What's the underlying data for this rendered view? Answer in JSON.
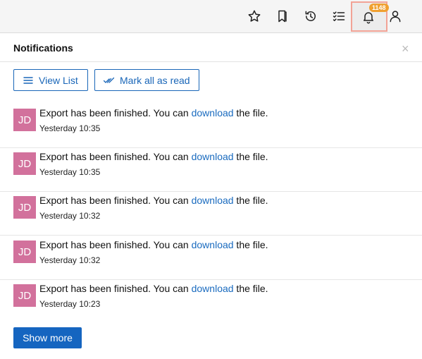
{
  "toolbar": {
    "icons": [
      "star-icon",
      "bookmark-icon",
      "history-icon",
      "checklist-icon",
      "bell-icon",
      "user-icon"
    ],
    "notification_count": "1148"
  },
  "panel": {
    "title": "Notifications",
    "close_glyph": "×",
    "view_list_label": "View List",
    "mark_all_read_label": "Mark all as read",
    "show_more_label": "Show more"
  },
  "notifications": [
    {
      "initials": "JD",
      "text_before": "Export has been finished. You can ",
      "link": "download",
      "text_after": " the file.",
      "time": "Yesterday 10:35"
    },
    {
      "initials": "JD",
      "text_before": "Export has been finished. You can ",
      "link": "download",
      "text_after": " the file.",
      "time": "Yesterday 10:35"
    },
    {
      "initials": "JD",
      "text_before": "Export has been finished. You can ",
      "link": "download",
      "text_after": " the file.",
      "time": "Yesterday 10:32"
    },
    {
      "initials": "JD",
      "text_before": "Export has been finished. You can ",
      "link": "download",
      "text_after": " the file.",
      "time": "Yesterday 10:32"
    },
    {
      "initials": "JD",
      "text_before": "Export has been finished. You can ",
      "link": "download",
      "text_after": " the file.",
      "time": "Yesterday 10:23"
    }
  ],
  "colors": {
    "accent": "#1565c0",
    "avatar": "#d2719c",
    "badge": "#f0a030"
  }
}
